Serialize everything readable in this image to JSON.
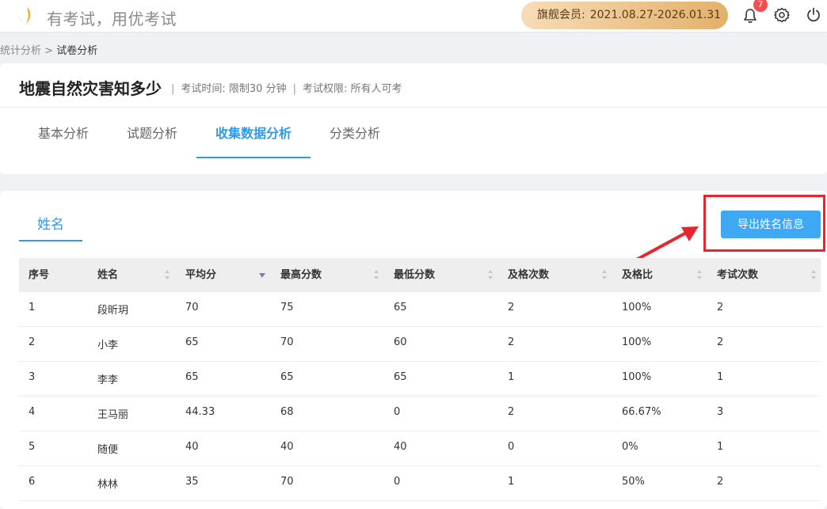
{
  "header": {
    "slogan": "有考试，用优考试",
    "vip_label": "旗舰会员:",
    "vip_period": "2021.08.27-2026.01.31",
    "notification_count": "7",
    "brand_color": "#f5a623",
    "icons": [
      "logo-icon",
      "bell-icon",
      "gear-icon",
      "power-icon"
    ]
  },
  "breadcrumb": {
    "parent": "统计分析",
    "separator": ">",
    "current": "试卷分析"
  },
  "exam": {
    "title": "地震自然灾害知多少",
    "time_label": "考试时间: 限制30 分钟",
    "permission_label": "考试权限: 所有人可考",
    "separator": "|"
  },
  "tabs": [
    {
      "label": "基本分析",
      "active": false
    },
    {
      "label": "试题分析",
      "active": false
    },
    {
      "label": "收集数据分析",
      "active": true
    },
    {
      "label": "分类分析",
      "active": false
    }
  ],
  "subtab": {
    "label": "姓名"
  },
  "export_button": {
    "label": "导出姓名信息"
  },
  "table": {
    "columns": [
      "序号",
      "姓名",
      "平均分",
      "最高分数",
      "最低分数",
      "及格次数",
      "及格比",
      "考试次数"
    ],
    "sorted_column": "平均分",
    "sort_direction": "descending",
    "rows": [
      [
        "1",
        "段昕玥",
        "70",
        "75",
        "65",
        "2",
        "100%",
        "2"
      ],
      [
        "2",
        "小李",
        "65",
        "70",
        "60",
        "2",
        "100%",
        "2"
      ],
      [
        "3",
        "李李",
        "65",
        "65",
        "65",
        "1",
        "100%",
        "1"
      ],
      [
        "4",
        "王马丽",
        "44.33",
        "68",
        "0",
        "2",
        "66.67%",
        "3"
      ],
      [
        "5",
        "随便",
        "40",
        "40",
        "40",
        "0",
        "0%",
        "1"
      ],
      [
        "6",
        "林林",
        "35",
        "70",
        "0",
        "1",
        "50%",
        "2"
      ]
    ]
  },
  "colors": {
    "accent": "#2f9ae8",
    "button": "#3fa8f4",
    "highlight_annotation": "#e8252a",
    "badge": "#f24e4e"
  }
}
